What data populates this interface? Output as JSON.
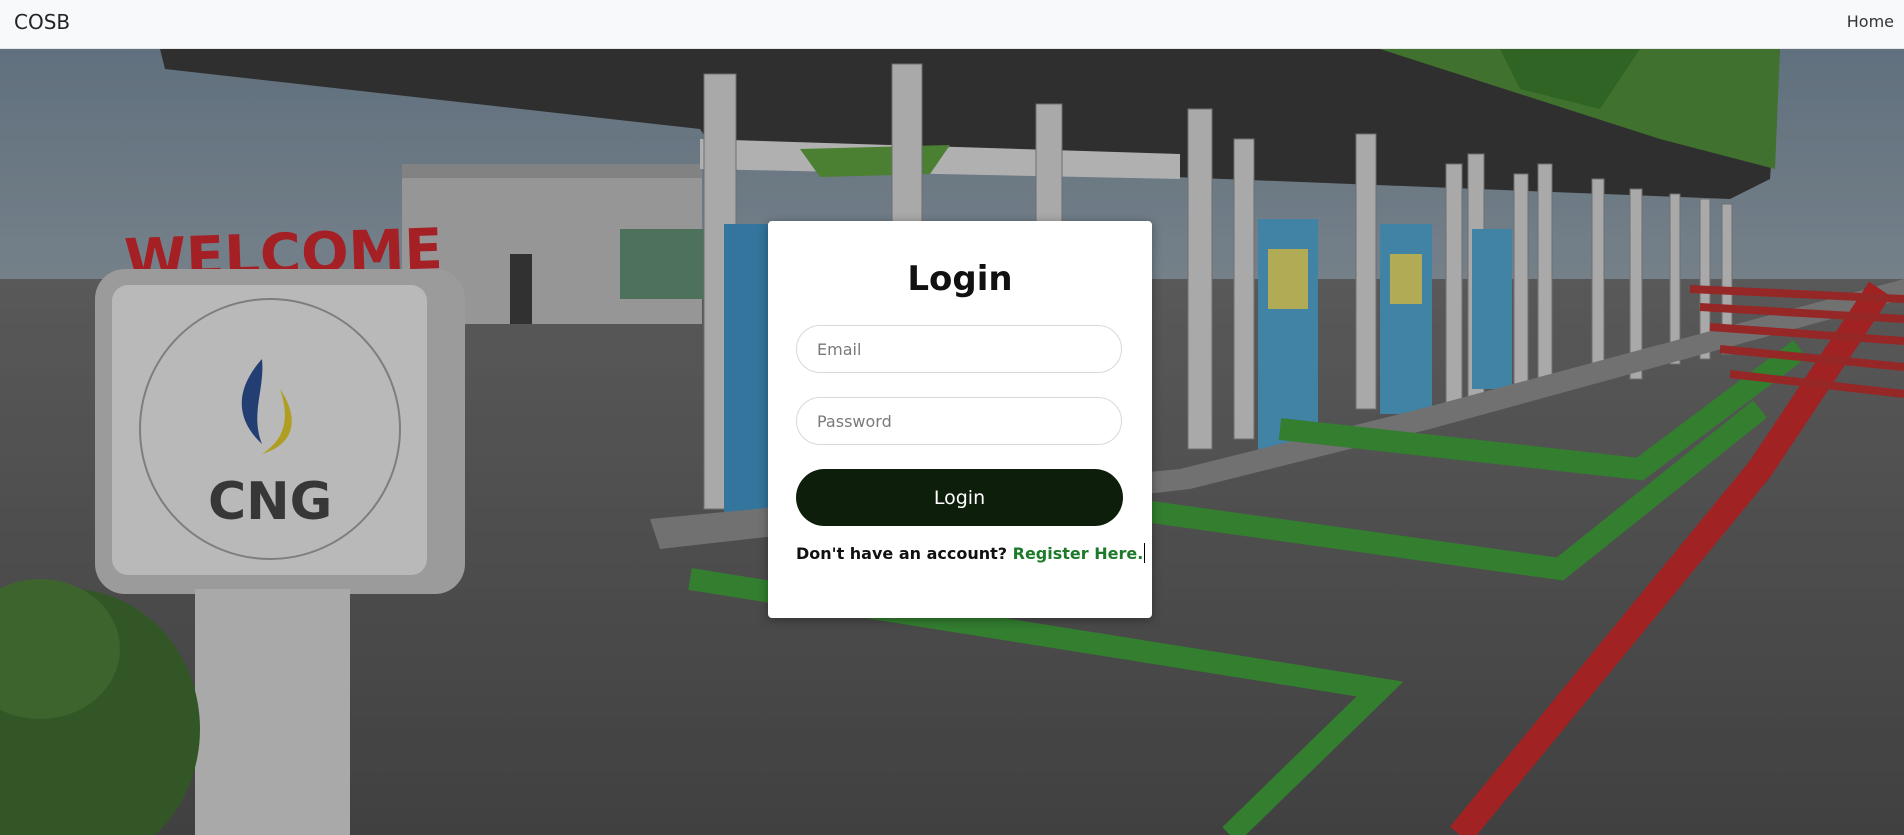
{
  "navbar": {
    "brand": "COSB",
    "home": "Home"
  },
  "hero": {
    "sign_welcome": "WELCOME",
    "sign_label": "CNG"
  },
  "login": {
    "title": "Login",
    "email_placeholder": "Email",
    "password_placeholder": "Password",
    "button_label": "Login",
    "register_prompt": "Don't have an account?",
    "register_link": "Register Here."
  },
  "colors": {
    "button_bg": "#0d1f0b",
    "link": "#1c7a2a",
    "navbar_bg": "#f8f9fa"
  }
}
